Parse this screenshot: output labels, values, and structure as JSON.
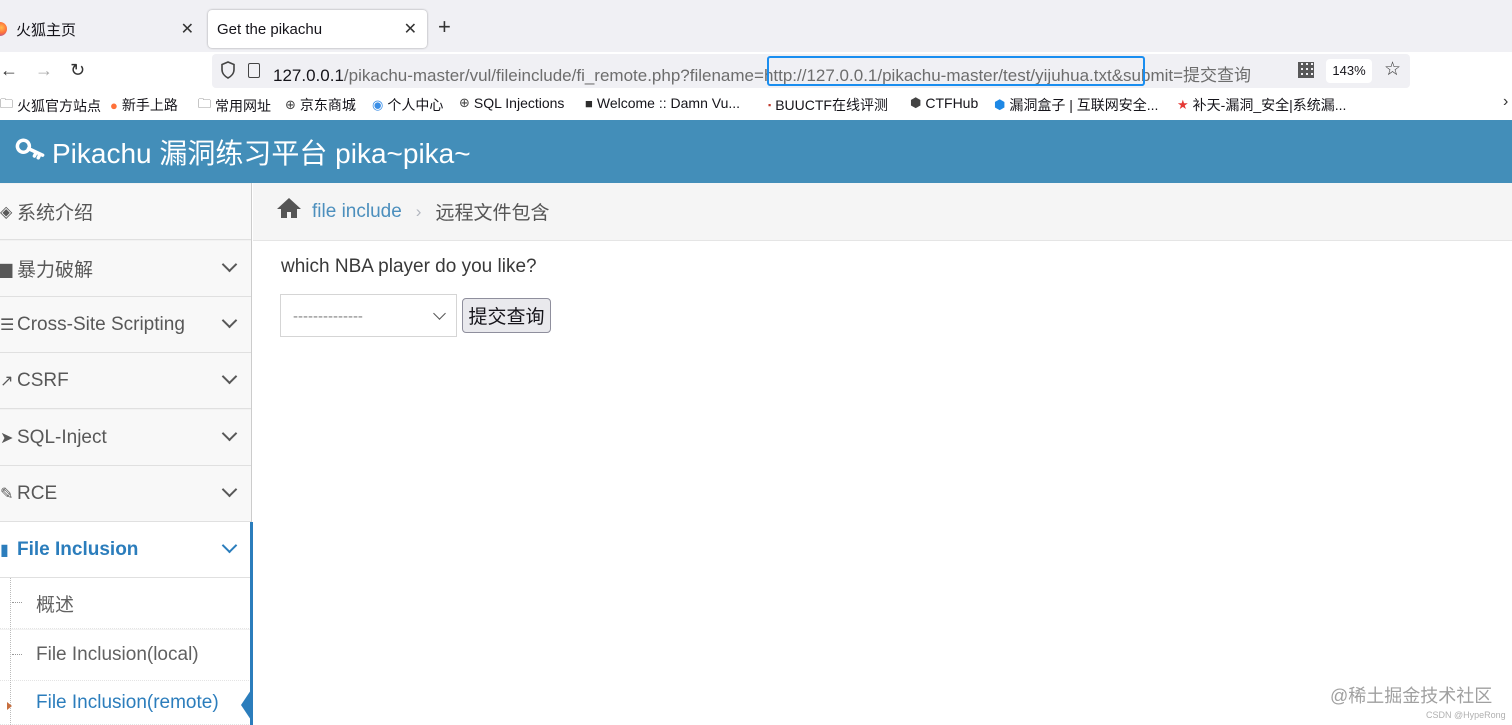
{
  "browser": {
    "tabs": [
      {
        "label": "火狐主页",
        "active": false
      },
      {
        "label": "Get the pikachu",
        "active": true
      }
    ],
    "new_tab": "+",
    "nav": {
      "back": "←",
      "forward": "→",
      "reload": "↻"
    },
    "url": {
      "host": "127.0.0.1",
      "path_before": "/pikachu-master/vul/fileinclude/fi_remote.php?filename",
      "highlighted": "=http://127.0.0.1/pikachu-master/test/yijuhua.txt",
      "path_after": "&submit=提交查询"
    },
    "zoom": "143%",
    "bookmarks": [
      {
        "label": "火狐官方站点",
        "icon": "folder-icon"
      },
      {
        "label": "新手上路",
        "icon": "firefox-icon"
      },
      {
        "label": "常用网址",
        "icon": "folder-icon"
      },
      {
        "label": "京东商城",
        "icon": "globe-icon"
      },
      {
        "label": "个人中心",
        "icon": "profile-icon"
      },
      {
        "label": "SQL Injections",
        "icon": "globe-icon"
      },
      {
        "label": "Welcome :: Damn Vu...",
        "icon": "dvwa-icon"
      },
      {
        "label": "BUUCTF在线评测",
        "icon": "buu-icon"
      },
      {
        "label": "CTFHub",
        "icon": "ctfhub-icon"
      },
      {
        "label": "漏洞盒子 | 互联网安全...",
        "icon": "box-icon"
      },
      {
        "label": "补天-漏洞_安全|系统漏...",
        "icon": "butian-icon"
      }
    ],
    "bookmarks_more": "›"
  },
  "page": {
    "brand": "Pikachu 漏洞练习平台 pika~pika~",
    "sidebar": [
      {
        "label": "系统介绍",
        "icon": "tag-icon",
        "expandable": false
      },
      {
        "label": "暴力破解",
        "icon": "lock-icon",
        "expandable": true
      },
      {
        "label": "Cross-Site Scripting",
        "icon": "list-icon",
        "expandable": true
      },
      {
        "label": "CSRF",
        "icon": "share-icon",
        "expandable": true
      },
      {
        "label": "SQL-Inject",
        "icon": "fighter-jet-icon",
        "expandable": true
      },
      {
        "label": "RCE",
        "icon": "pencil-icon",
        "expandable": true
      },
      {
        "label": "File Inclusion",
        "icon": "file-icon",
        "expandable": true,
        "active": true
      }
    ],
    "sub_items": [
      {
        "label": "概述"
      },
      {
        "label": "File Inclusion(local)"
      },
      {
        "label": "File Inclusion(remote)",
        "current": true
      }
    ],
    "breadcrumb": {
      "link": "file include",
      "separator": "›",
      "current": "远程文件包含"
    },
    "question": "which NBA player do you like?",
    "select_value": "--------------",
    "submit_label": "提交查询"
  },
  "watermark": {
    "main": "@稀土掘金技术社区",
    "small": "CSDN @HypeRong"
  },
  "colors": {
    "header": "#438eb9",
    "active": "#2b7dbc",
    "url_highlight": "#1a8ef0"
  }
}
